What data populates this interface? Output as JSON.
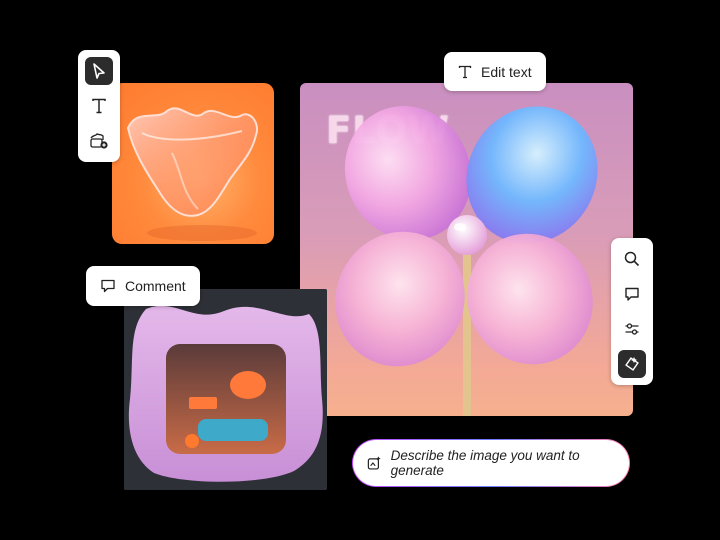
{
  "canvas": {
    "background": "#000000",
    "accent_gradient": [
      "#c24bff",
      "#6c7bff",
      "#ff7fb0"
    ]
  },
  "images": {
    "glass_bowl": {
      "description_icon": "image-glass-bowl"
    },
    "flow_poster": {
      "headline": "FLOW"
    },
    "storefront": {
      "description_icon": "image-storefront"
    }
  },
  "left_toolbar": {
    "tools": [
      {
        "icon": "select-pointer-icon",
        "active": true
      },
      {
        "icon": "text-tool-icon",
        "active": false
      },
      {
        "icon": "add-image-icon",
        "active": false
      }
    ]
  },
  "right_toolbar": {
    "tools": [
      {
        "icon": "search-icon",
        "active": false
      },
      {
        "icon": "comment-icon",
        "active": false
      },
      {
        "icon": "adjustments-icon",
        "active": false
      },
      {
        "icon": "generative-fill-icon",
        "active": true
      }
    ]
  },
  "edit_text_button": {
    "label": "Edit text",
    "icon": "text-icon"
  },
  "comment_button": {
    "label": "Comment",
    "icon": "comment-icon"
  },
  "prompt_input": {
    "placeholder": "Describe the image you want to generate",
    "icon": "generate-image-icon"
  }
}
